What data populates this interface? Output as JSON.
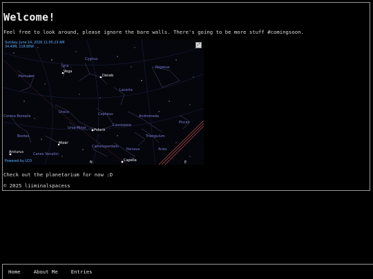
{
  "page": {
    "title": "Welcome!",
    "intro": "Feel free to look around, please ignore the bare walls. There's going to be more stuff #comingsoon.",
    "cta": "Check out the planetarium for now :D",
    "copyright": "© 2025 liiminalspacess"
  },
  "planetarium": {
    "datetime_line1": "Sunday, June 14, 2026 11:05:23 AM",
    "datetime_line2": "34.49N, 118.86W",
    "credit": "Powered by LCO",
    "fullscreen_icon": "expand-icon",
    "constellations": [
      "Cygnus",
      "Lyra",
      "Hercules",
      "Pegasus",
      "Lacerta",
      "Draco",
      "Cepheus",
      "Andromeda",
      "Corona Borealis",
      "Bootes",
      "Ursa Minor",
      "Cassiopeia",
      "Pisces",
      "Triangulum",
      "Perseus",
      "Aries",
      "Camelopardalis",
      "Canes Venatici"
    ],
    "stars": [
      "Vega",
      "Deneb",
      "Polaris",
      "Arcturus",
      "Mizar",
      "Capella"
    ],
    "compass": [
      "N",
      "E"
    ]
  },
  "nav": {
    "items": [
      {
        "label": "Home"
      },
      {
        "label": "About Me"
      },
      {
        "label": "Entries"
      }
    ]
  }
}
